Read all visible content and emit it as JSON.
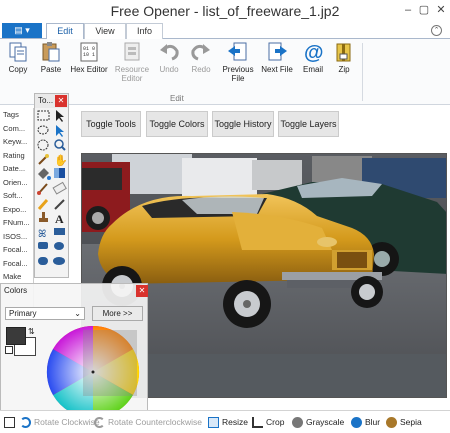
{
  "window": {
    "title": "Free Opener - list_of_freeware_1.jp2",
    "minimize": "–",
    "maximize": "▢",
    "close": "✕"
  },
  "tabs": [
    {
      "label": "Edit"
    },
    {
      "label": "View"
    },
    {
      "label": "Info"
    }
  ],
  "ribbon": {
    "group_label": "Edit",
    "buttons": [
      {
        "label": "Copy"
      },
      {
        "label": "Paste"
      },
      {
        "label": "Hex Editor"
      },
      {
        "label": "Resource Editor"
      },
      {
        "label": "Undo"
      },
      {
        "label": "Redo"
      },
      {
        "label": "Previous File"
      },
      {
        "label": "Next File"
      },
      {
        "label": "Email"
      },
      {
        "label": "Zip"
      }
    ]
  },
  "sidebar": {
    "items": [
      "Tags",
      "Com...",
      "Keyw...",
      "Rating",
      "Date...",
      "Orien...",
      "Soft...",
      "Expo...",
      "FNum...",
      "ISOS...",
      "Focal...",
      "Focal...",
      "Make"
    ]
  },
  "tools_panel": {
    "title": "To..."
  },
  "toggle_buttons": [
    "Toggle Tools",
    "Toggle Colors",
    "Toggle History",
    "Toggle Layers"
  ],
  "colors_panel": {
    "title": "Colors",
    "mode": "Primary",
    "more_label": "More >>",
    "primary_color": "#3a3a3a",
    "secondary_color": "#ffffff"
  },
  "bottom_toolbar": [
    {
      "label": "Rotate Clockwise"
    },
    {
      "label": "Rotate Counterclockwise"
    },
    {
      "label": "Resize"
    },
    {
      "label": "Crop"
    },
    {
      "label": "Grayscale"
    },
    {
      "label": "Blur"
    },
    {
      "label": "Sepia"
    }
  ],
  "colors": {
    "accent": "#1a73c7",
    "close_red": "#d9322d",
    "car_yellow": "#d49a1c"
  }
}
